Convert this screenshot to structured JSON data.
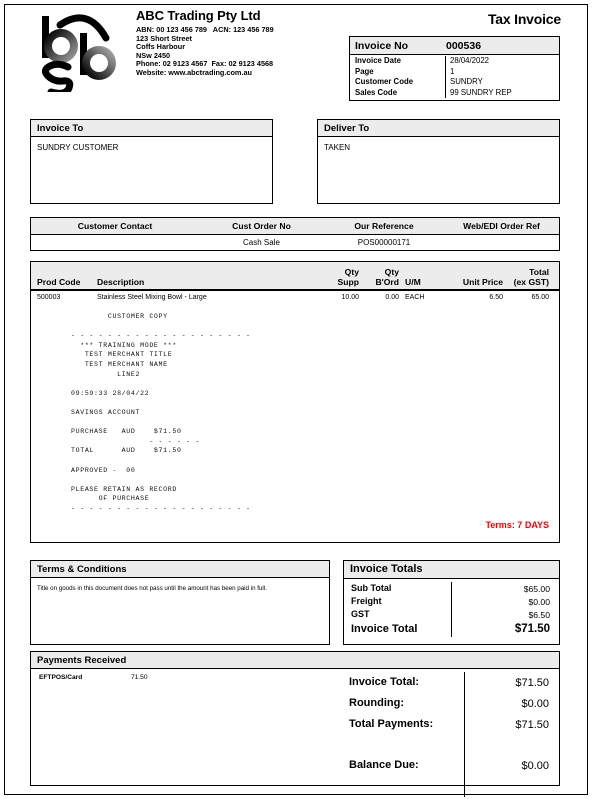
{
  "document": {
    "title": "Tax Invoice"
  },
  "company": {
    "name": "ABC Trading Pty Ltd",
    "abn_acn": "ABN: 00 123 456 789   ACN: 123 456 789",
    "street": "123 Short Street",
    "city": "Coffs Harbour",
    "state_postcode": "NSw 2450",
    "phone_fax": "Phone: 02 9123 4567  Fax: 02 9123 4568",
    "website": "Website: www.abctrading.com.au",
    "logo_text": "bsb"
  },
  "meta": {
    "invoice_no_label": "Invoice No",
    "invoice_no_value": "000536",
    "rows": [
      {
        "label": "Invoice Date",
        "value": "28/04/2022"
      },
      {
        "label": "Page",
        "value": "1"
      },
      {
        "label": "Customer Code",
        "value": "SUNDRY"
      },
      {
        "label": "Sales Code",
        "value": "99 SUNDRY REP"
      }
    ]
  },
  "invoice_to": {
    "title": "Invoice To",
    "lines": [
      "SUNDRY CUSTOMER"
    ]
  },
  "deliver_to": {
    "title": "Deliver To",
    "lines": [
      "TAKEN"
    ]
  },
  "references": {
    "headers": [
      "Customer Contact",
      "Cust Order No",
      "Our Reference",
      "Web/EDI Order Ref"
    ],
    "values": [
      "",
      "Cash Sale",
      "POS00000171",
      ""
    ]
  },
  "items": {
    "headers": {
      "prod_code": "Prod Code",
      "description": "Description",
      "qty_supp_l1": "Qty",
      "qty_supp_l2": "Supp",
      "qty_bord_l1": "Qty",
      "qty_bord_l2": "B'Ord",
      "um": "U/M",
      "unit_price": "Unit Price",
      "total_l1": "Total",
      "total_l2": "(ex GST)"
    },
    "rows": [
      {
        "prod_code": "500003",
        "description": "Stainless Steel Mixing Bowl - Large",
        "qty_supp": "10.00",
        "qty_bord": "0.00",
        "um": "EACH",
        "unit_price": "6.50",
        "total": "65.00"
      }
    ],
    "receipt_text": "        CUSTOMER COPY\n\n- - - - - - - - - - - - - - - - - - - -\n  *** TRAINING MODE ***\n   TEST MERCHANT TITLE\n   TEST MERCHANT NAME\n          LINE2\n\n09:59:33 28/04/22\n\nSAVINGS ACCOUNT\n\nPURCHASE   AUD    $71.50\n                 - - - - - -\nTOTAL      AUD    $71.50\n\nAPPROVED -  00\n\nPLEASE RETAIN AS RECORD\n      OF PURCHASE\n- - - - - - - - - - - - - - - - - - - -",
    "terms_note": "Terms: 7 DAYS",
    "terms_note_color": "#ff0000"
  },
  "terms_conditions": {
    "title": "Terms & Conditions",
    "body": "Title on goods in this document does not pass until the amount has been paid in full."
  },
  "invoice_totals": {
    "title": "Invoice Totals",
    "rows": [
      {
        "label": "Sub Total",
        "value": "$65.00"
      },
      {
        "label": "Freight",
        "value": "$0.00"
      },
      {
        "label": "GST",
        "value": "$6.50"
      }
    ],
    "grand": {
      "label": "Invoice Total",
      "value": "$71.50"
    }
  },
  "payments_received": {
    "title": "Payments Received",
    "entries": [
      {
        "method": "EFTPOS/Card",
        "amount": "71.50"
      }
    ],
    "summary": [
      {
        "label": "Invoice Total:",
        "value": "$71.50"
      },
      {
        "label": "Rounding:",
        "value": "$0.00"
      },
      {
        "label": "Total Payments:",
        "value": "$71.50"
      }
    ],
    "balance": {
      "label": "Balance Due:",
      "value": "$0.00"
    }
  }
}
